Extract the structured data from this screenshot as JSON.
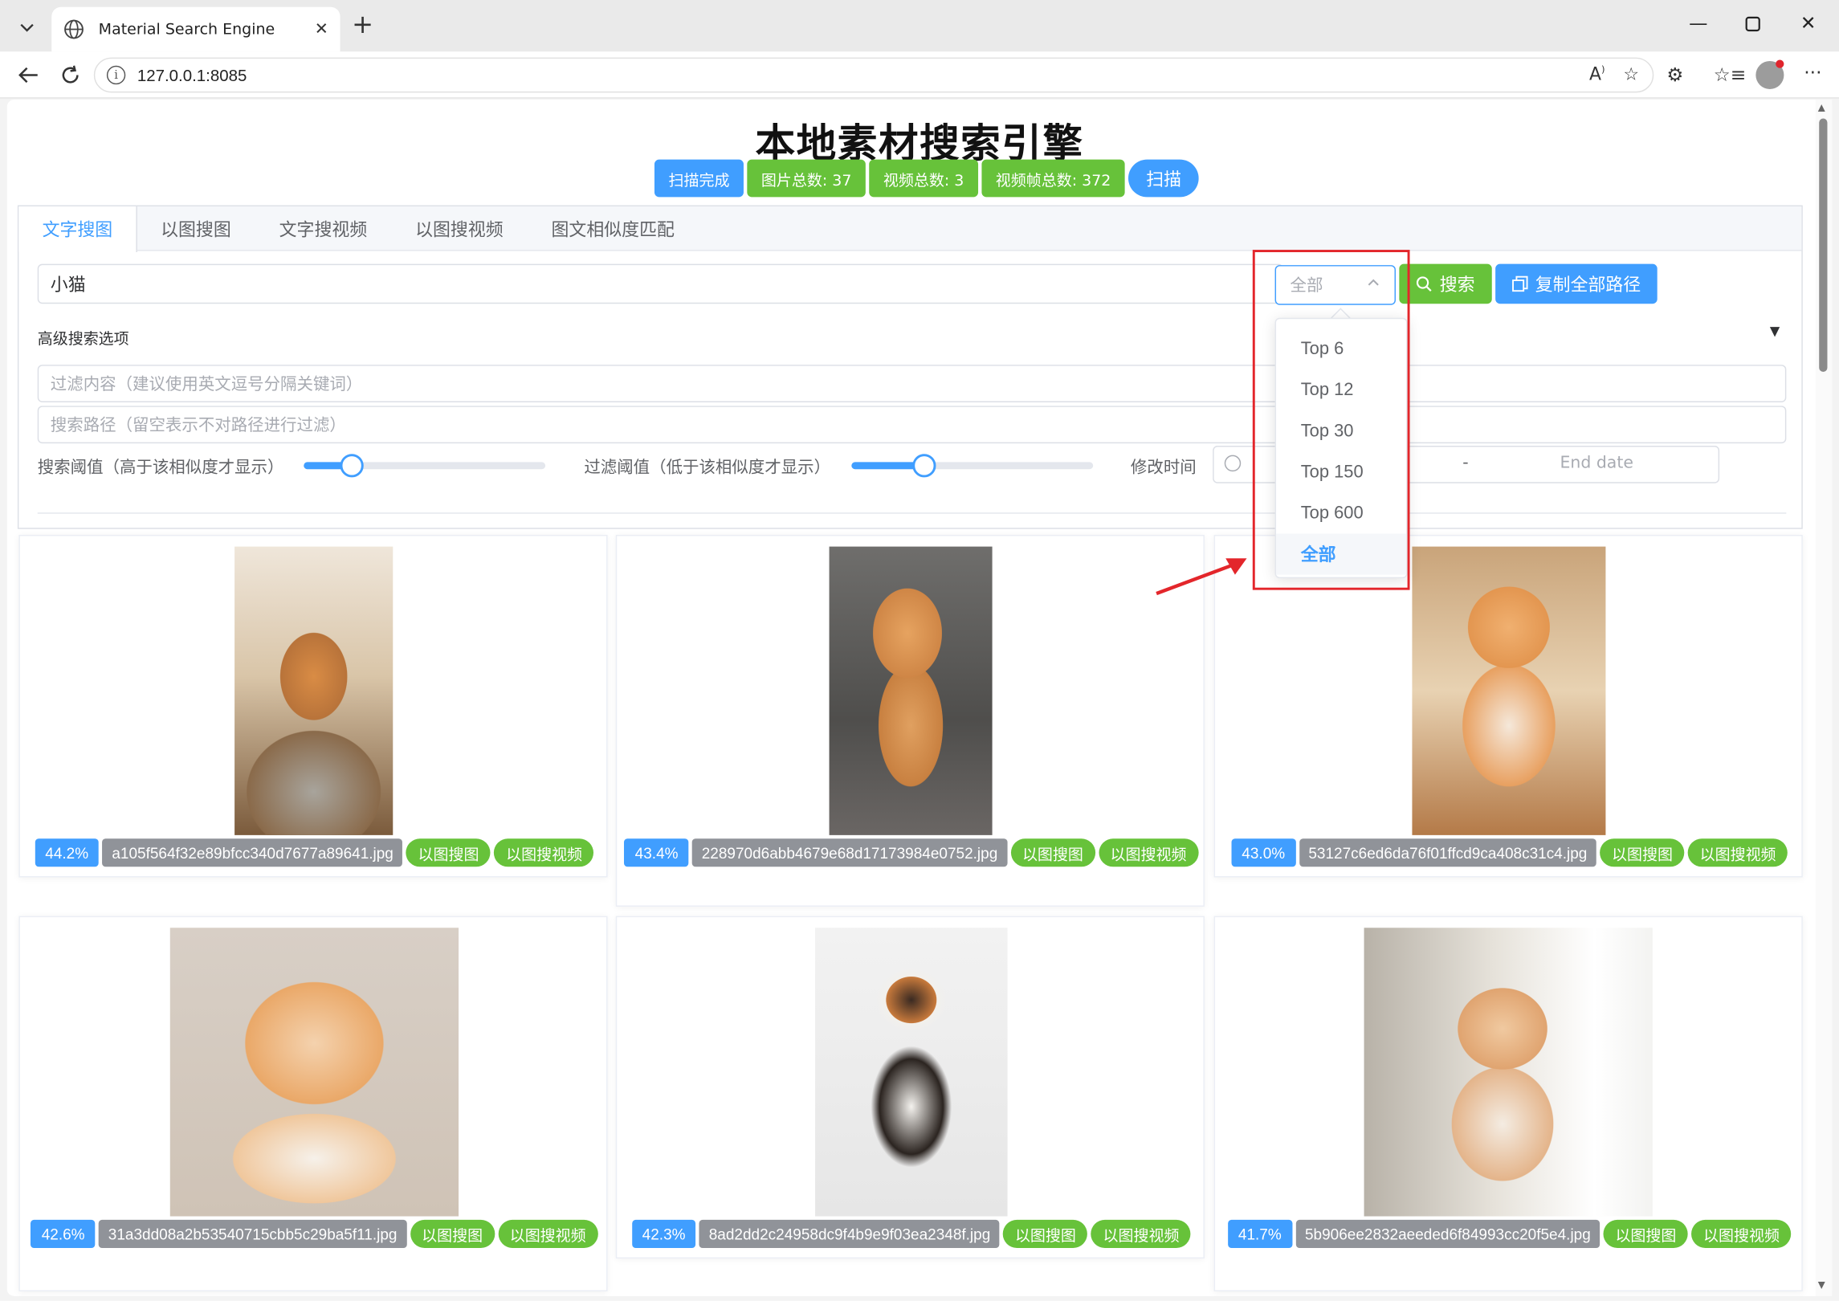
{
  "browser": {
    "tab_title": "Material Search Engine",
    "url": "127.0.0.1:8085"
  },
  "app": {
    "title": "本地素材搜索引擎",
    "stats": [
      "扫描完成",
      "图片总数: 37",
      "视频总数: 3",
      "视频帧总数: 372"
    ],
    "scan_button": "扫描"
  },
  "tabs": [
    "文字搜图",
    "以图搜图",
    "文字搜视频",
    "以图搜视频",
    "图文相似度匹配"
  ],
  "search": {
    "query": "小猫",
    "top_select": "全部",
    "search_button": "搜索",
    "copy_button": "复制全部路径"
  },
  "advanced": {
    "title": "高级搜索选项",
    "filter_placeholder": "过滤内容（建议使用英文逗号分隔关键词）",
    "path_placeholder": "搜索路径（留空表示不对路径进行过滤）",
    "search_threshold_label": "搜索阈值（高于该相似度才显示）",
    "search_threshold_level": 0.2,
    "filter_threshold_label": "过滤阈值（低于该相似度才显示）",
    "filter_threshold_level": 0.3,
    "mtime_label": "修改时间",
    "date_separator": "-",
    "end_date_placeholder": "End date"
  },
  "dropdown": {
    "options": [
      "Top 6",
      "Top 12",
      "Top 30",
      "Top 150",
      "Top 600",
      "全部"
    ],
    "selected": "全部"
  },
  "results": [
    {
      "pct": "44.2%",
      "file": "a105f564f32e89bfcc340d7677a89641.jpg",
      "btn1": "以图搜图",
      "btn2": "以图搜视频"
    },
    {
      "pct": "43.4%",
      "file": "228970d6abb4679e68d17173984e0752.jpg",
      "btn1": "以图搜图",
      "btn2": "以图搜视频"
    },
    {
      "pct": "43.0%",
      "file": "53127c6ed6da76f01ffcd9ca408c31c4.jpg",
      "btn1": "以图搜图",
      "btn2": "以图搜视频"
    },
    {
      "pct": "42.6%",
      "file": "31a3dd08a2b53540715cbb5c29ba5f11.jpg",
      "btn1": "以图搜图",
      "btn2": "以图搜视频"
    },
    {
      "pct": "42.3%",
      "file": "8ad2dd2c24958dc9f4b9e9f03ea2348f.jpg",
      "btn1": "以图搜图",
      "btn2": "以图搜视频"
    },
    {
      "pct": "41.7%",
      "file": "5b906ee2832aeeded6f84993cc20f5e4.jpg",
      "btn1": "以图搜图",
      "btn2": "以图搜视频"
    }
  ],
  "colors": {
    "primary": "#409eff",
    "success": "#67c23a",
    "info": "#909399",
    "annotation_red": "#e3262b"
  }
}
